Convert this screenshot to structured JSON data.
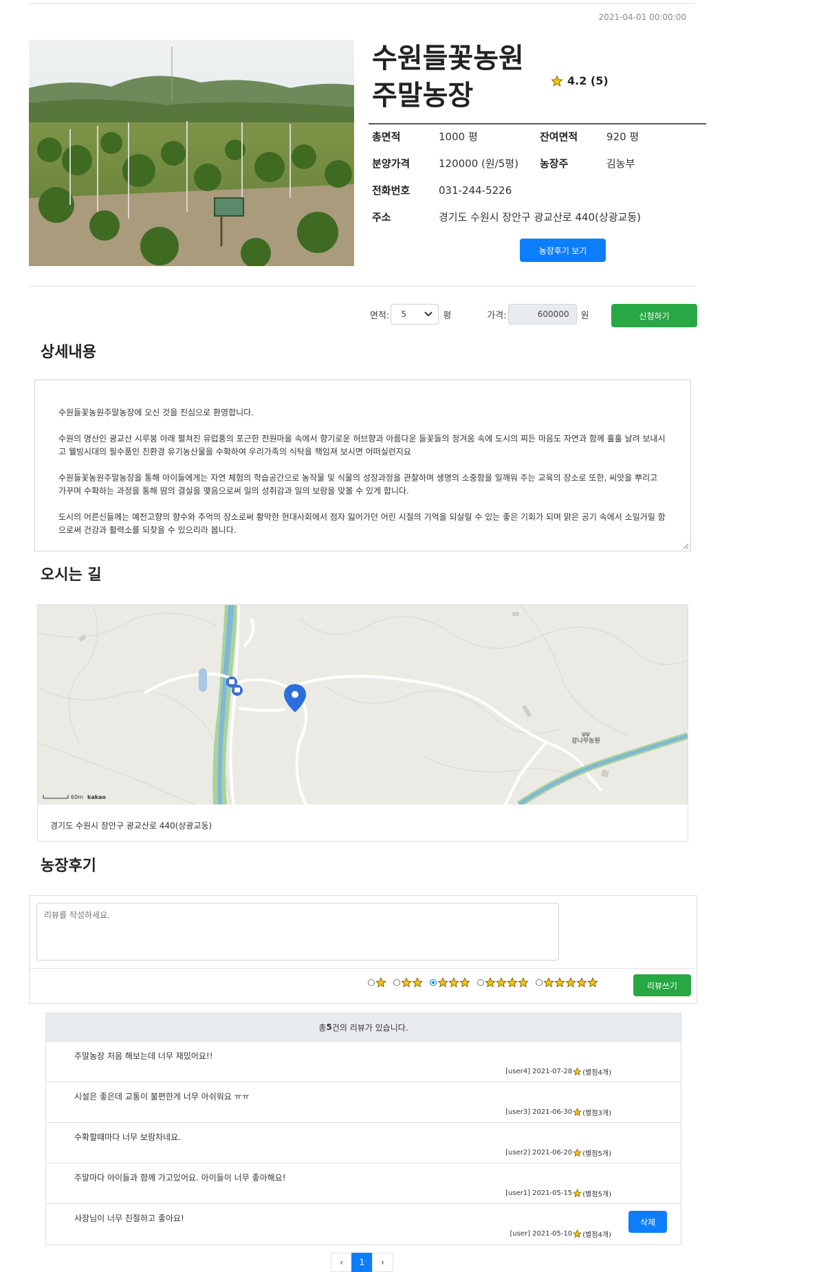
{
  "date": "2021-04-01 00:00:00",
  "farm": {
    "title_line1": "수원들꽃농원",
    "title_line2": "주말농장",
    "rating": "4.2 (5)",
    "info": {
      "total_area_label": "총면적",
      "total_area_value": "1000 평",
      "remaining_area_label": "잔여면적",
      "remaining_area_value": "920 평",
      "price_label": "분양가격",
      "price_value": "120000 (원/5평)",
      "owner_label": "농장주",
      "owner_value": "김농부",
      "phone_label": "전화번호",
      "phone_value": "031-244-5226",
      "address_label": "주소",
      "address_value": "경기도 수원시 장안구 광교산로 440(상광교동)"
    },
    "review_view_button": "농장후기 보기"
  },
  "apply": {
    "area_label": "면적:",
    "area_selected": "5",
    "area_unit": "평",
    "price_label": "가격:",
    "price_value": "600000",
    "price_unit": "원",
    "apply_button": "신청하기"
  },
  "detail": {
    "heading": "상세내용",
    "paragraphs": [
      "수원들꽃농원주말농장에 오신 것을 진심으로 환영합니다.",
      "수원의 명산인 광교산 시루봉 아래 펼쳐진 유럽풍의 포근한 전원마을 속에서 향기로운 허브향과 아름다운 들꽃들의 정겨움 속에 도시의 찌든 마음도 자연과 함께 훌훌 날려 보내시고 웰빙시대의 필수품인 친환경 유기농산물을 수확하여 우리가족의 식탁을 책임져 보시면 어떠실런지요",
      "수원들꽃농원주말농장을 통해 아이들에게는 자연 체험의 학습공간으로 농작물 및 식물의 성장과정을 관찰하며 생명의 소중함을 일깨워 주는 교육의 장소로 또한, 씨앗을 뿌리고 가꾸며 수확하는 과정을 통해 땀의 결실을 맺음으로써 일의 성취감과 일의 보람을 맞볼 수 있게 합니다.",
      "도시의 어른신들께는 예전고향의 향수와 추억의 장소로써 황막한 현대사회에서 점자 잃어가던 어린 시절의 기억을 되살릴 수 있는 좋은 기회가 되며 맑은 공기 속에서 소일거릴 함으로써 건강과 활력소를 되찾을 수 있으리라 봅니다."
    ]
  },
  "directions": {
    "heading": "오시는 길",
    "map_label": "감나무농원",
    "scale_label": "60m",
    "map_brand": "kakao",
    "address": "경기도 수원시 장안구 광교산로 440(상광교동)"
  },
  "reviews": {
    "heading": "농장후기",
    "textarea_placeholder": "리뷰를 작성하세요.",
    "star_options": [
      1,
      2,
      3,
      4,
      5
    ],
    "selected_stars": 3,
    "write_button": "리뷰쓰기",
    "total_prefix": "총 ",
    "total_count": "5",
    "total_suffix": "건의 리뷰가 있습니다.",
    "items": [
      {
        "text": "주말농장 처음 해보는데 너무 재밌어요!!",
        "user": "[user4]",
        "date": "2021-07-28",
        "score": "(별점4개)"
      },
      {
        "text": "시설은 좋은데 교통이 불편한게 너무 아쉬워요 ㅠㅠ",
        "user": "[user3]",
        "date": "2021-06-30",
        "score": "(별점3개)"
      },
      {
        "text": "수확할때마다 너무 보람차네요.",
        "user": "[user2]",
        "date": "2021-06-20",
        "score": "(별점5개)"
      },
      {
        "text": "주말마다 아이들과 함께 가고있어요. 아이들이 너무 좋아해요!",
        "user": "[user1]",
        "date": "2021-05-15",
        "score": "(별점5개)"
      },
      {
        "text": "사장님이 너무 친절하고 좋아요!",
        "user": "[user]",
        "date": "2021-05-10",
        "score": "(별점4개)",
        "delete_button": "삭제"
      }
    ]
  },
  "pagination": {
    "prev": "‹",
    "current": "1",
    "next": "›"
  },
  "colors": {
    "primary": "#0d7efb",
    "success": "#28a745",
    "star": "#f5c518"
  }
}
